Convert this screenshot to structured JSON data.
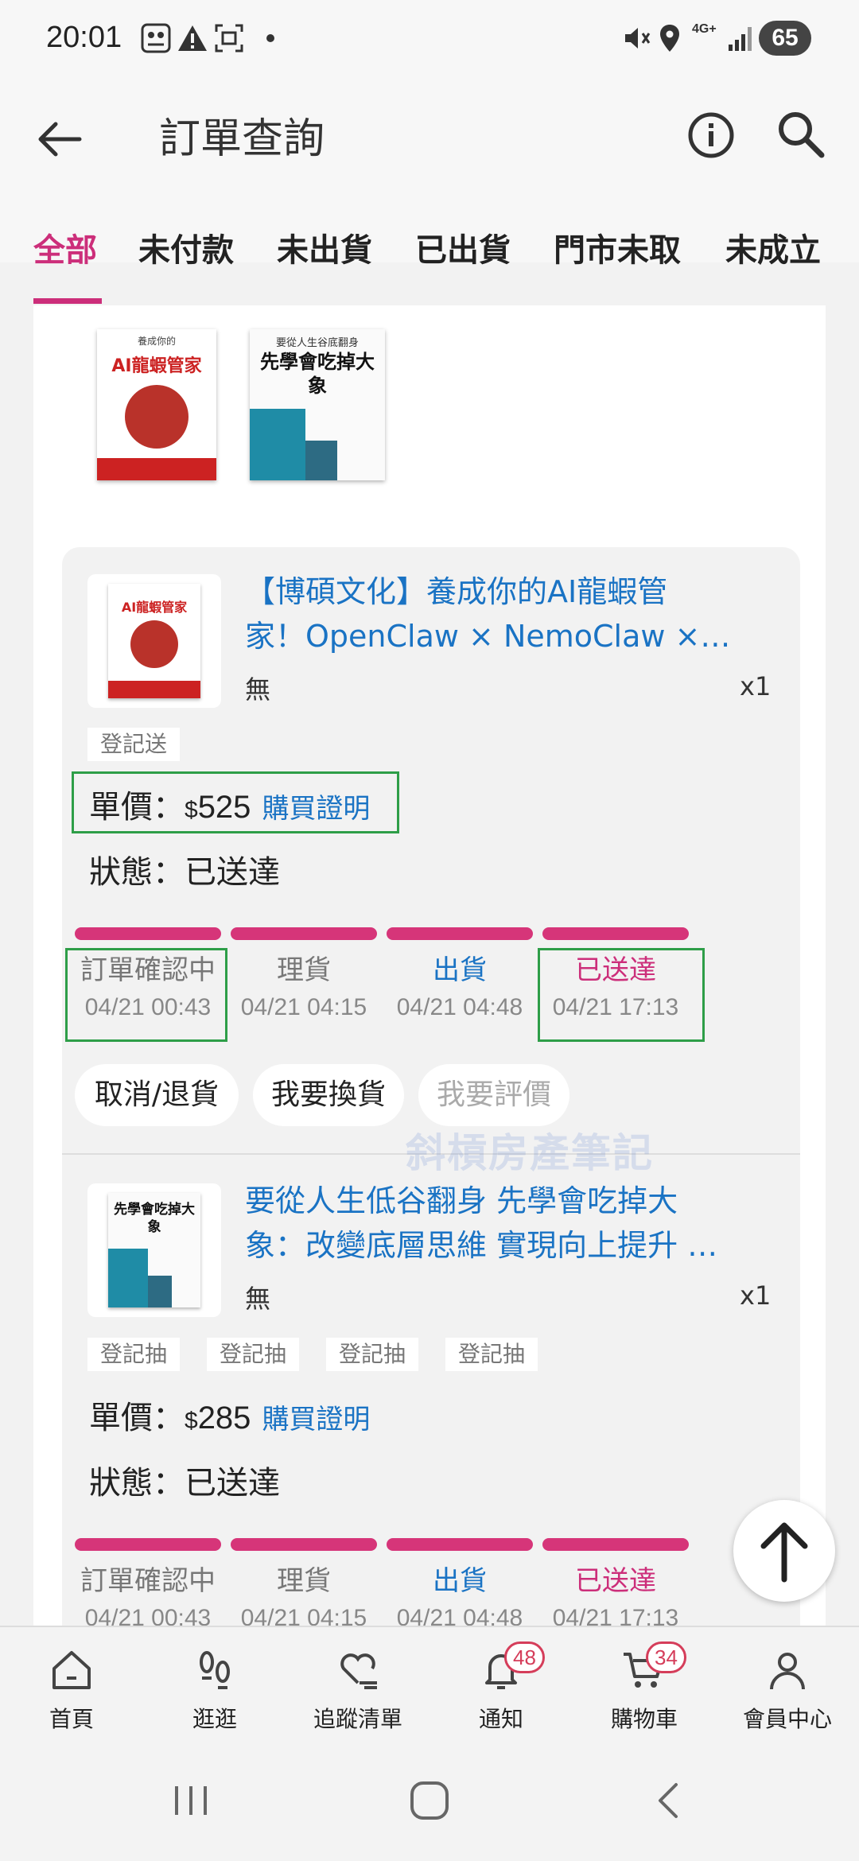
{
  "status_bar": {
    "time": "20:01",
    "network": "4G+",
    "battery": "65"
  },
  "header": {
    "title": "訂單查詢",
    "back_icon": "arrow-left-icon",
    "info_icon": "info-icon",
    "search_icon": "search-icon"
  },
  "tabs": [
    {
      "label": "全部",
      "active": true
    },
    {
      "label": "未付款",
      "active": false
    },
    {
      "label": "未出貨",
      "active": false
    },
    {
      "label": "已出貨",
      "active": false
    },
    {
      "label": "門市未取",
      "active": false
    },
    {
      "label": "未成立",
      "active": false
    }
  ],
  "top_books": [
    {
      "cover_title": "AI龍蝦管家",
      "cover_caption": "養成你的"
    },
    {
      "cover_title": "先學會吃掉大象",
      "cover_caption": "要從人生谷底翻身"
    }
  ],
  "items": [
    {
      "title": "【博碩文化】養成你的AI龍蝦管家！OpenClaw × NemoClaw ×…",
      "title_line1": "【博碩文化】養成你的AI龍蝦管",
      "title_line2": "家！OpenClaw × NemoClaw ×…",
      "spec": "無",
      "qty": "x1",
      "tags": [
        "登記送"
      ],
      "price_label": "單價：",
      "price_currency": "$",
      "price_amount": "525",
      "proof_label": "購買證明",
      "status_label": "狀態：",
      "status_value": "已送達",
      "steps": [
        {
          "label": "訂單確認中",
          "time": "04/21 00:43",
          "color": "gray"
        },
        {
          "label": "理貨",
          "time": "04/21 04:15",
          "color": "gray"
        },
        {
          "label": "出貨",
          "time": "04/21 04:48",
          "color": "blue"
        },
        {
          "label": "已送達",
          "time": "04/21 17:13",
          "color": "pink"
        }
      ],
      "actions": [
        {
          "label": "取消/退貨",
          "enabled": true
        },
        {
          "label": "我要換貨",
          "enabled": true
        },
        {
          "label": "我要評價",
          "enabled": false
        }
      ]
    },
    {
      "title": "要從人生低谷翻身 先學會吃掉大象：改變底層思維 實現向上提升 …",
      "title_line1": "要從人生低谷翻身 先學會吃掉大",
      "title_line2": "象：改變底層思維 實現向上提升 …",
      "spec": "無",
      "qty": "x1",
      "tags": [
        "登記抽",
        "登記抽",
        "登記抽",
        "登記抽"
      ],
      "price_label": "單價：",
      "price_currency": "$",
      "price_amount": "285",
      "proof_label": "購買證明",
      "status_label": "狀態：",
      "status_value": "已送達",
      "steps": [
        {
          "label": "訂單確認中",
          "time": "04/21 00:43",
          "color": "gray"
        },
        {
          "label": "理貨",
          "time": "04/21 04:15",
          "color": "gray"
        },
        {
          "label": "出貨",
          "time": "04/21 04:48",
          "color": "blue"
        },
        {
          "label": "已送達",
          "time": "04/21 17:13",
          "color": "pink"
        }
      ]
    }
  ],
  "watermark": "斜槓房產筆記",
  "bottom_nav": [
    {
      "label": "首頁",
      "icon": "home-icon"
    },
    {
      "label": "逛逛",
      "icon": "footprints-icon"
    },
    {
      "label": "追蹤清單",
      "icon": "heart-list-icon"
    },
    {
      "label": "通知",
      "icon": "bell-icon",
      "badge": "48"
    },
    {
      "label": "購物車",
      "icon": "cart-icon",
      "badge": "34"
    },
    {
      "label": "會員中心",
      "icon": "person-icon"
    }
  ],
  "colors": {
    "accent_pink": "#cc2e7a",
    "progress_pink": "#d63579",
    "link_blue": "#1a73c4",
    "highlight_green": "#2e9e48",
    "badge_red": "#d53d5a"
  }
}
